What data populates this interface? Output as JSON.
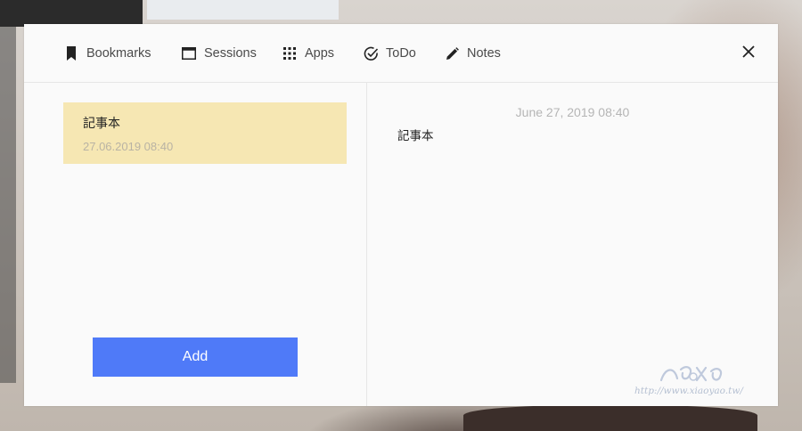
{
  "tabs": [
    {
      "label": "Bookmarks",
      "icon": "bookmark-icon"
    },
    {
      "label": "Sessions",
      "icon": "window-icon"
    },
    {
      "label": "Apps",
      "icon": "apps-grid-icon"
    },
    {
      "label": "ToDo",
      "icon": "check-circle-icon"
    },
    {
      "label": "Notes",
      "icon": "pencil-icon"
    }
  ],
  "close_icon": "close-icon",
  "notes_list": [
    {
      "title": "記事本",
      "date": "27.06.2019 08:40",
      "selected": true,
      "color": "#f6e7b3"
    }
  ],
  "add_button": {
    "label": "Add",
    "color": "#4f7af8"
  },
  "detail": {
    "date": "June 27, 2019 08:40",
    "body": "記事本"
  },
  "watermark": {
    "text": "http://www.xiaoyao.tw/"
  }
}
